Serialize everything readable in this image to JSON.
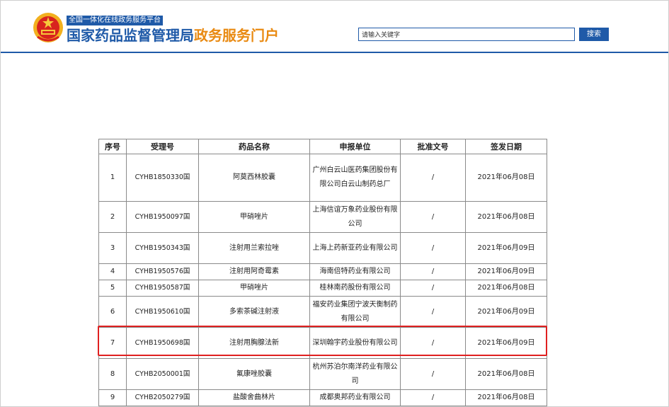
{
  "header": {
    "subtitle_badge": "全国一体化在线政务服务平台",
    "title_main": "国家药品监督管理局",
    "title_accent": "政务服务门户",
    "search": {
      "value": "请输入关键字",
      "button_label": "搜索"
    }
  },
  "table": {
    "columns": [
      "序号",
      "受理号",
      "药品名称",
      "申报单位",
      "批准文号",
      "签发日期"
    ],
    "rows": [
      {
        "no": "1",
        "accept_no": "CYHB1850330国",
        "drug_name": "阿莫西林胶囊",
        "applicant": "广州白云山医药集团股份有限公司白云山制药总厂",
        "approval_no": "/",
        "issue_date": "2021年06月08日"
      },
      {
        "no": "2",
        "accept_no": "CYHB1950097国",
        "drug_name": "甲硝唑片",
        "applicant": "上海信谊万象药业股份有限公司",
        "approval_no": "/",
        "issue_date": "2021年06月08日"
      },
      {
        "no": "3",
        "accept_no": "CYHB1950343国",
        "drug_name": "注射用兰索拉唑",
        "applicant": "上海上药新亚药业有限公司",
        "approval_no": "/",
        "issue_date": "2021年06月09日"
      },
      {
        "no": "4",
        "accept_no": "CYHB1950576国",
        "drug_name": "注射用阿奇霉素",
        "applicant": "海南倍特药业有限公司",
        "approval_no": "/",
        "issue_date": "2021年06月09日"
      },
      {
        "no": "5",
        "accept_no": "CYHB1950587国",
        "drug_name": "甲硝唑片",
        "applicant": "桂林南药股份有限公司",
        "approval_no": "/",
        "issue_date": "2021年06月08日"
      },
      {
        "no": "6",
        "accept_no": "CYHB1950610国",
        "drug_name": "多索茶碱注射液",
        "applicant": "福安药业集团宁波天衡制药有限公司",
        "approval_no": "/",
        "issue_date": "2021年06月09日"
      },
      {
        "no": "7",
        "accept_no": "CYHB1950698国",
        "drug_name": "注射用胸腺法新",
        "applicant": "深圳翰宇药业股份有限公司",
        "approval_no": "/",
        "issue_date": "2021年06月09日"
      },
      {
        "no": "8",
        "accept_no": "CYHB2050001国",
        "drug_name": "氟康唑胶囊",
        "applicant": "杭州苏泊尔南洋药业有限公司",
        "approval_no": "/",
        "issue_date": "2021年06月08日"
      },
      {
        "no": "9",
        "accept_no": "CYHB2050279国",
        "drug_name": "盐酸舍曲林片",
        "applicant": "成都奥邦药业有限公司",
        "approval_no": "/",
        "issue_date": "2021年06月08日"
      }
    ]
  },
  "colors": {
    "brand_blue": "#1f5aa8",
    "accent_orange": "#e98a12",
    "highlight_red": "#e02020"
  }
}
